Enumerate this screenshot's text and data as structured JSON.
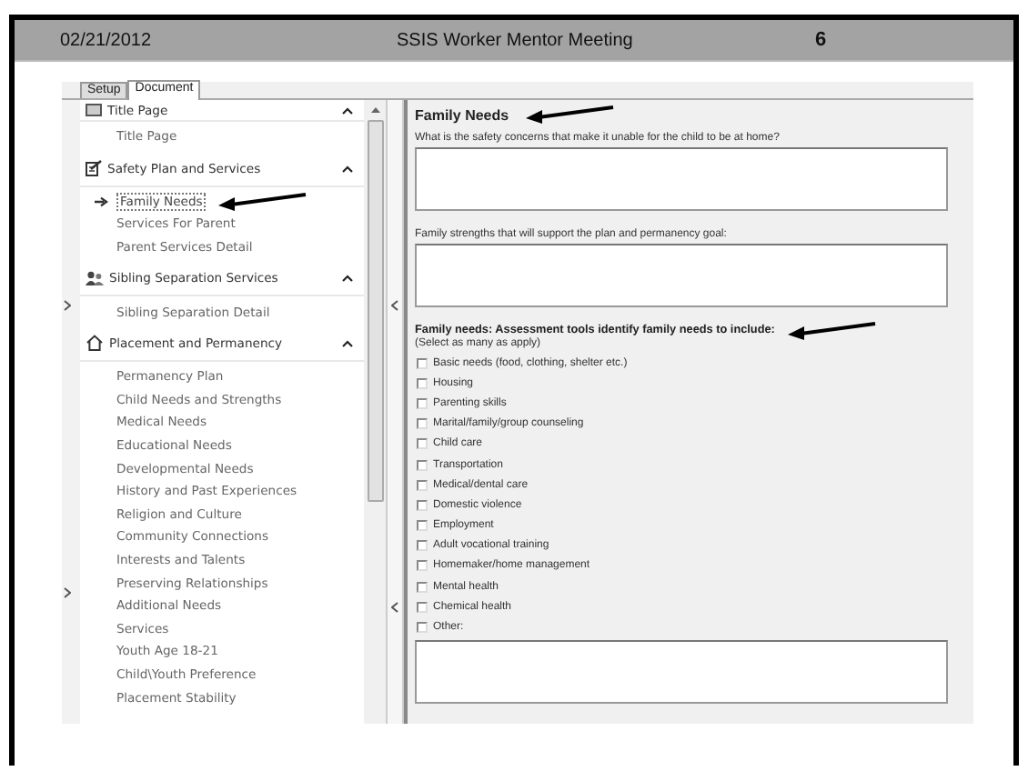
{
  "slide": {
    "date": "02/21/2012",
    "title": "SSIS Worker Mentor Meeting",
    "page_number": "6"
  },
  "tabs": [
    {
      "label": "Setup",
      "selected": false
    },
    {
      "label": "Document",
      "selected": true
    }
  ],
  "navigation": [
    {
      "title": "Title Page",
      "expanded": true,
      "items": [
        {
          "label": "Title Page",
          "selected": false
        }
      ]
    },
    {
      "title": "Safety Plan and Services",
      "expanded": true,
      "items": [
        {
          "label": "Family Needs",
          "selected": true,
          "pointer": true
        },
        {
          "label": "Services For Parent",
          "selected": false
        },
        {
          "label": "Parent Services Detail",
          "selected": false
        }
      ]
    },
    {
      "title": "Sibling Separation Services",
      "expanded": true,
      "items": [
        {
          "label": "Sibling Separation Detail",
          "selected": false
        }
      ]
    },
    {
      "title": "Placement and Permanency",
      "expanded": true,
      "items": [
        {
          "label": "Permanency Plan",
          "selected": false
        },
        {
          "label": "Child Needs and Strengths",
          "selected": false
        },
        {
          "label": "Medical Needs",
          "selected": false
        },
        {
          "label": "Educational Needs",
          "selected": false
        },
        {
          "label": "Developmental Needs",
          "selected": false
        },
        {
          "label": "History and Past Experiences",
          "selected": false
        },
        {
          "label": "Religion and Culture",
          "selected": false
        },
        {
          "label": "Community Connections",
          "selected": false
        },
        {
          "label": "Interests and Talents",
          "selected": false
        },
        {
          "label": "Preserving Relationships",
          "selected": false
        },
        {
          "label": "Additional Needs",
          "selected": false
        },
        {
          "label": "Services",
          "selected": false
        },
        {
          "label": "Youth Age 18-21",
          "selected": false
        },
        {
          "label": "Child\\Youth Preference",
          "selected": false
        },
        {
          "label": "Placement Stability",
          "selected": false
        }
      ]
    }
  ],
  "form": {
    "title": "Family Needs",
    "pointer": true,
    "fields": [
      {
        "kind": "textarea",
        "label": "What is the safety concerns that make it unable for the child to be at home?"
      },
      {
        "kind": "textarea",
        "label": "Family strengths that will support the plan and permanency goal:"
      },
      {
        "kind": "checklist",
        "label": "Family needs: Assessment tools identify family needs to include:",
        "pointer": true,
        "note": "(Select as many as apply)",
        "options": [
          {
            "label": "Basic needs (food, clothing, shelter etc.)",
            "checked": false
          },
          {
            "label": "Housing",
            "checked": false
          },
          {
            "label": "Parenting skills",
            "checked": false
          },
          {
            "label": "Marital/family/group counseling",
            "checked": false
          },
          {
            "label": "Child care",
            "checked": false
          },
          {
            "label": "Transportation",
            "checked": false
          },
          {
            "label": "Medical/dental care",
            "checked": false
          },
          {
            "label": "Domestic violence",
            "checked": false
          },
          {
            "label": "Employment",
            "checked": false
          },
          {
            "label": "Adult vocational training",
            "checked": false
          },
          {
            "label": "Homemaker/home management",
            "checked": false
          },
          {
            "label": "Mental health",
            "checked": false
          },
          {
            "label": "Chemical health",
            "checked": false
          },
          {
            "label": "Other:",
            "checked": false
          }
        ]
      },
      {
        "kind": "textarea"
      }
    ]
  }
}
